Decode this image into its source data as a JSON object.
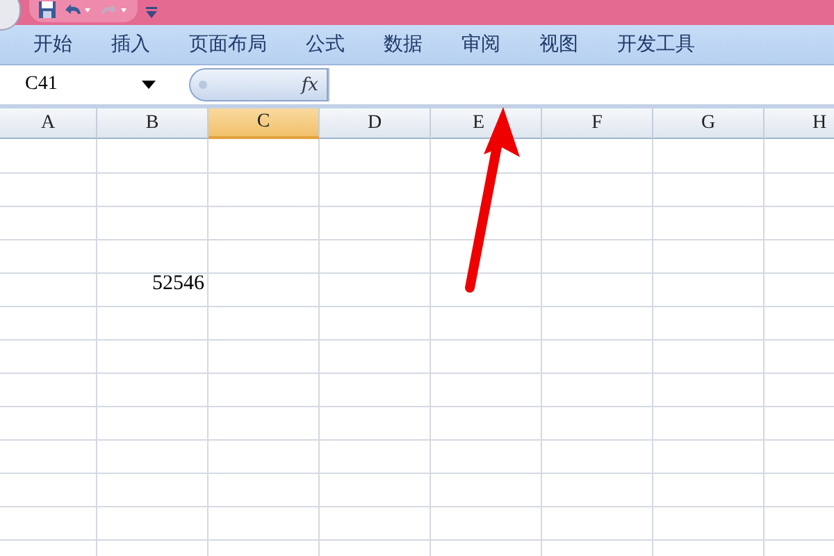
{
  "ribbon_tabs": [
    {
      "label": "开始",
      "selected": false
    },
    {
      "label": "插入",
      "selected": false
    },
    {
      "label": "页面布局",
      "selected": false
    },
    {
      "label": "公式",
      "selected": false
    },
    {
      "label": "数据",
      "selected": false
    },
    {
      "label": "审阅",
      "selected": false
    },
    {
      "label": "视图",
      "selected": false
    },
    {
      "label": "开发工具",
      "selected": false
    }
  ],
  "formula_bar": {
    "name_box": "C41",
    "fx": "fx"
  },
  "sheet": {
    "columns": [
      {
        "label": "A",
        "selected": false
      },
      {
        "label": "B",
        "selected": false
      },
      {
        "label": "C",
        "selected": true
      },
      {
        "label": "D",
        "selected": false
      },
      {
        "label": "E",
        "selected": false
      },
      {
        "label": "F",
        "selected": false
      },
      {
        "label": "G",
        "selected": false
      },
      {
        "label": "H",
        "selected": false
      }
    ],
    "rows": [
      {
        "cells": []
      },
      {
        "cells": []
      },
      {
        "cells": []
      },
      {
        "cells": []
      },
      {
        "cells": [
          null,
          "52546"
        ]
      },
      {
        "cells": []
      },
      {
        "cells": []
      },
      {
        "cells": []
      },
      {
        "cells": []
      },
      {
        "cells": []
      },
      {
        "cells": []
      },
      {
        "cells": []
      },
      {
        "cells": []
      }
    ]
  }
}
